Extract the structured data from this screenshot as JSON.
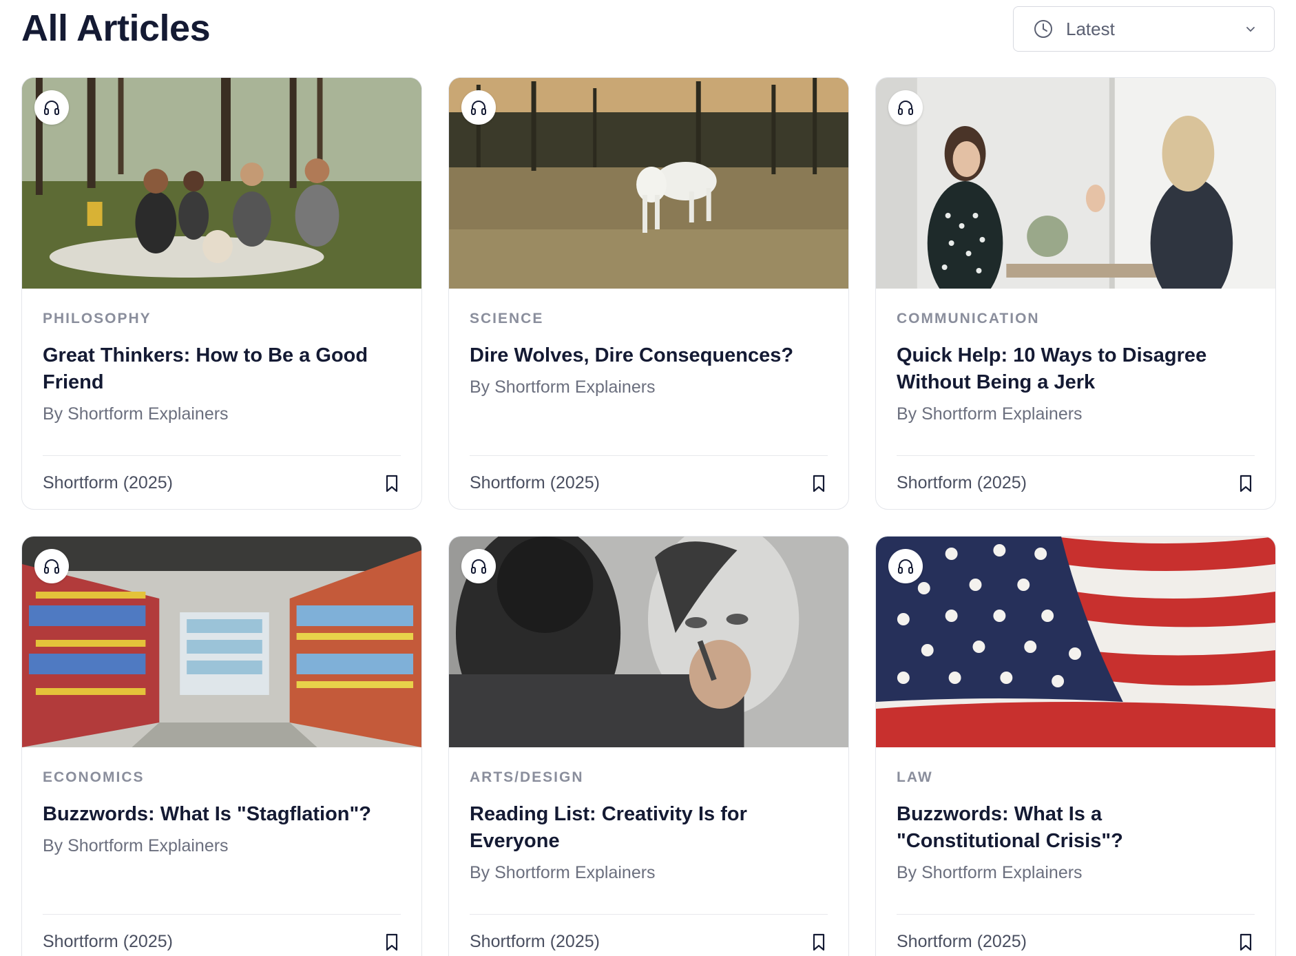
{
  "page": {
    "title": "All Articles"
  },
  "sort": {
    "icon": "clock-icon",
    "label": "Latest",
    "dropdown_icon": "chevron-down-icon"
  },
  "articles": [
    {
      "category": "PHILOSOPHY",
      "title": "Great Thinkers: How to Be a Good Friend",
      "author": "By Shortform Explainers",
      "source": "Shortform (2025)",
      "image": "friends picnic in park with dog"
    },
    {
      "category": "SCIENCE",
      "title": "Dire Wolves, Dire Consequences?",
      "author": "By Shortform Explainers",
      "source": "Shortform (2025)",
      "image": "white wolf in grassy forest"
    },
    {
      "category": "COMMUNICATION",
      "title": "Quick Help: 10 Ways to Disagree Without Being a Jerk",
      "author": "By Shortform Explainers",
      "source": "Shortform (2025)",
      "image": "two women talking by window"
    },
    {
      "category": "ECONOMICS",
      "title": "Buzzwords: What Is \"Stagflation\"?",
      "author": "By Shortform Explainers",
      "source": "Shortform (2025)",
      "image": "grocery store aisle"
    },
    {
      "category": "ARTS/DESIGN",
      "title": "Reading List: Creativity Is for Everyone",
      "author": "By Shortform Explainers",
      "source": "Shortform (2025)",
      "image": "artist drawing charcoal portrait"
    },
    {
      "category": "LAW",
      "title": "Buzzwords: What Is a \"Constitutional Crisis\"?",
      "author": "By Shortform Explainers",
      "source": "Shortform (2025)",
      "image": "american flag"
    }
  ],
  "icons": {
    "audio": "headphones-icon",
    "bookmark": "bookmark-icon"
  },
  "colors": {
    "heading": "#141a33",
    "category": "#8a8e9c",
    "border": "#e4e6eb"
  }
}
